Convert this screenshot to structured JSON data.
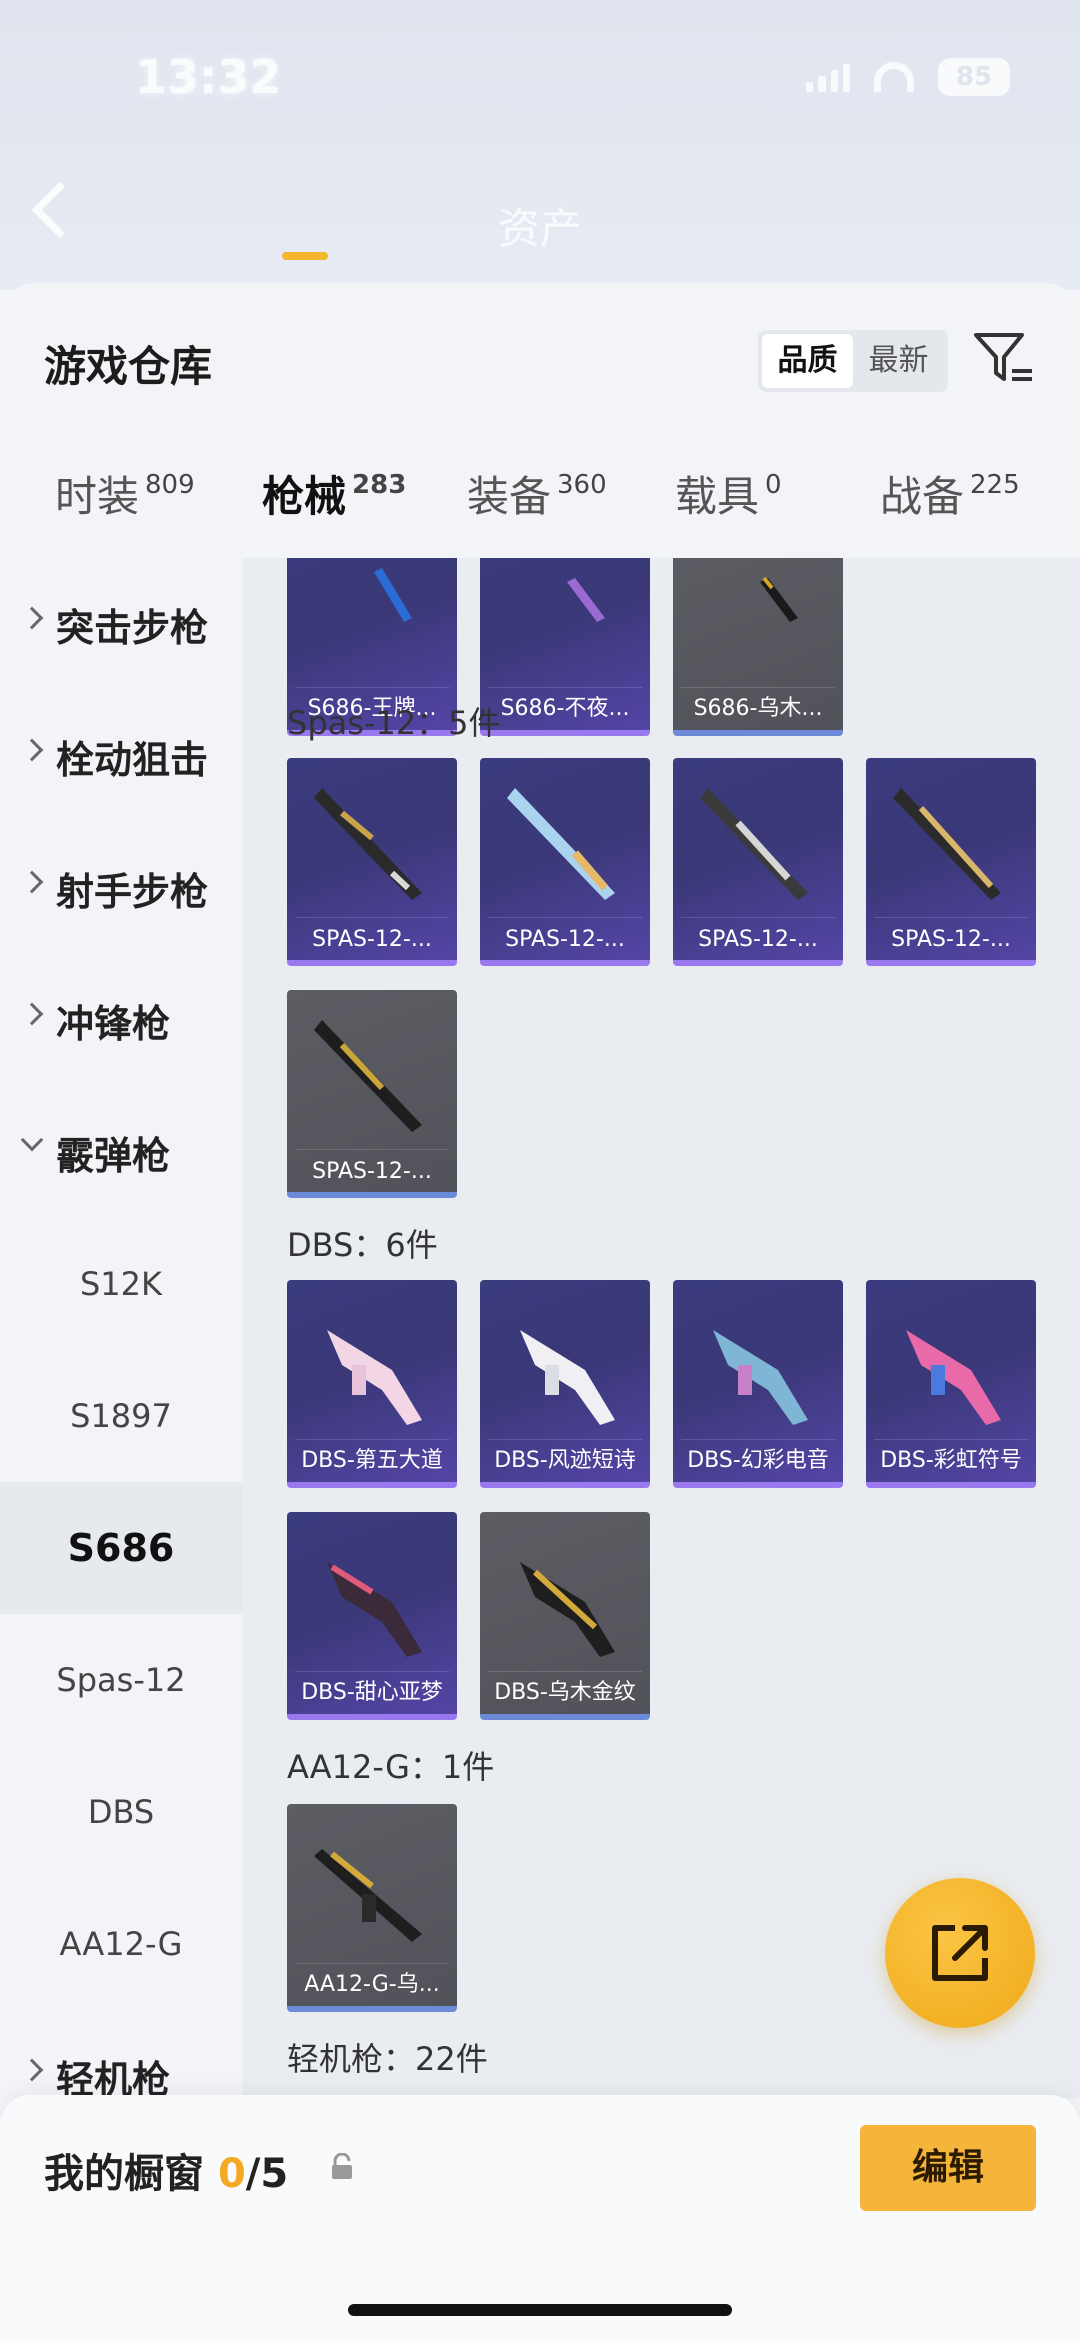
{
  "status": {
    "time": "13:32",
    "battery": "85"
  },
  "nav": {
    "title": "资产"
  },
  "header": {
    "title": "游戏仓库",
    "sort": [
      "品质",
      "最新"
    ]
  },
  "tabs": [
    {
      "label": "时装",
      "count": "809"
    },
    {
      "label": "枪械",
      "count": "283"
    },
    {
      "label": "装备",
      "count": "360"
    },
    {
      "label": "载具",
      "count": "0"
    },
    {
      "label": "战备",
      "count": "225"
    }
  ],
  "sidebar": {
    "categories": [
      "突击步枪",
      "栓动狙击",
      "射手步枪",
      "冲锋枪",
      "霰弹枪",
      "轻机枪"
    ],
    "subs": [
      "S12K",
      "S1897",
      "S686",
      "Spas-12",
      "DBS",
      "AA12-G"
    ]
  },
  "sections": {
    "s686": {
      "items": [
        "S686-王牌...",
        "S686-不夜...",
        "S686-乌木..."
      ]
    },
    "spas": {
      "label": "Spas-12：5件",
      "items": [
        "SPAS-12-...",
        "SPAS-12-...",
        "SPAS-12-...",
        "SPAS-12-...",
        "SPAS-12-..."
      ]
    },
    "dbs": {
      "label": "DBS：6件",
      "items": [
        "DBS-第五大道",
        "DBS-风迹短诗",
        "DBS-幻彩电音",
        "DBS-彩虹符号",
        "DBS-甜心亚梦",
        "DBS-乌木金纹"
      ]
    },
    "aa12": {
      "label": "AA12-G：1件",
      "items": [
        "AA12-G-乌..."
      ]
    },
    "lmg": {
      "label": "轻机枪：22件"
    }
  },
  "bottom": {
    "label": "我的橱窗",
    "count": "0",
    "total": "/5",
    "edit": "编辑"
  }
}
